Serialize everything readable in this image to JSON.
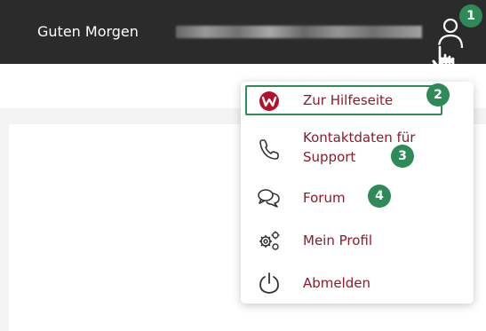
{
  "header": {
    "greeting": "Guten Morgen",
    "background_color": "#2b2b2b",
    "user_icon": "user-icon"
  },
  "menu": {
    "label_color": "#8c1a2c",
    "items": [
      {
        "label": "Zur Hilfeseite",
        "icon": "w-logo-icon",
        "highlighted": true
      },
      {
        "label": "Kontaktdaten für Support",
        "label_line1": "Kontaktdaten für",
        "label_line2": "Support",
        "icon": "phone-icon"
      },
      {
        "label": "Forum",
        "icon": "chat-bubbles-icon"
      },
      {
        "label": "Mein Profil",
        "icon": "settings-gears-icon"
      },
      {
        "label": "Abmelden",
        "icon": "power-icon"
      }
    ]
  },
  "badges": {
    "accent_color": "#2e8b57",
    "b1": "1",
    "b2": "2",
    "b3": "3",
    "b4": "4"
  }
}
